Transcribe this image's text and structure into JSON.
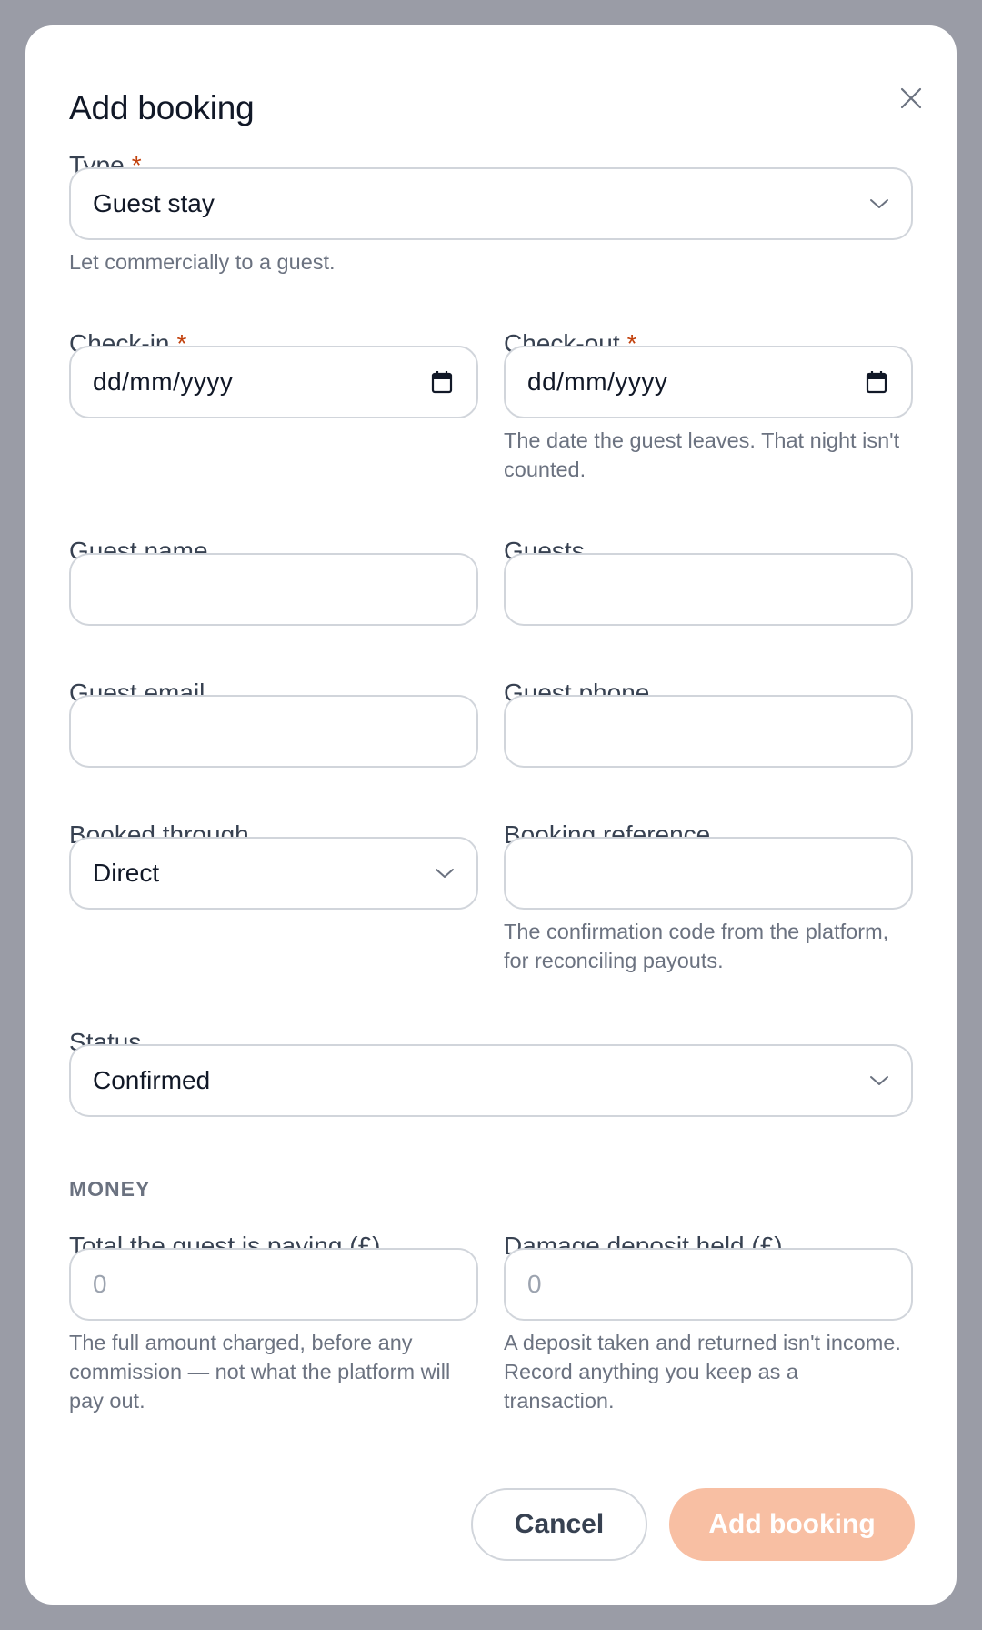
{
  "modal": {
    "title": "Add booking",
    "close_icon": "close-icon"
  },
  "type": {
    "label": "Type",
    "required": "*",
    "value": "Guest stay",
    "help": "Let commercially to a guest."
  },
  "check_in": {
    "label": "Check-in",
    "required": "*",
    "placeholder": "dd/mm/yyyy"
  },
  "check_out": {
    "label": "Check-out",
    "required": "*",
    "placeholder": "dd/mm/yyyy",
    "help": "The date the guest leaves. That night isn't counted."
  },
  "guest_name": {
    "label": "Guest name",
    "value": ""
  },
  "guests": {
    "label": "Guests",
    "value": ""
  },
  "guest_email": {
    "label": "Guest email",
    "value": ""
  },
  "guest_phone": {
    "label": "Guest phone",
    "value": ""
  },
  "booked_through": {
    "label": "Booked through",
    "value": "Direct"
  },
  "booking_reference": {
    "label": "Booking reference",
    "value": "",
    "help": "The confirmation code from the platform, for reconciling payouts."
  },
  "status": {
    "label": "Status",
    "value": "Confirmed"
  },
  "money": {
    "section_label": "MONEY",
    "total": {
      "label": "Total the guest is paying (£)",
      "placeholder": "0",
      "help": "The full amount charged, before any commission — not what the platform will pay out."
    },
    "deposit": {
      "label": "Damage deposit held (£)",
      "placeholder": "0",
      "help": "A deposit taken and returned isn't income. Record anything you keep as a transaction."
    }
  },
  "footer": {
    "cancel_label": "Cancel",
    "submit_label": "Add booking"
  },
  "colors": {
    "accent_disabled": "#f8bfa3",
    "required": "#c2410c",
    "backdrop": "#9a9ca6"
  }
}
